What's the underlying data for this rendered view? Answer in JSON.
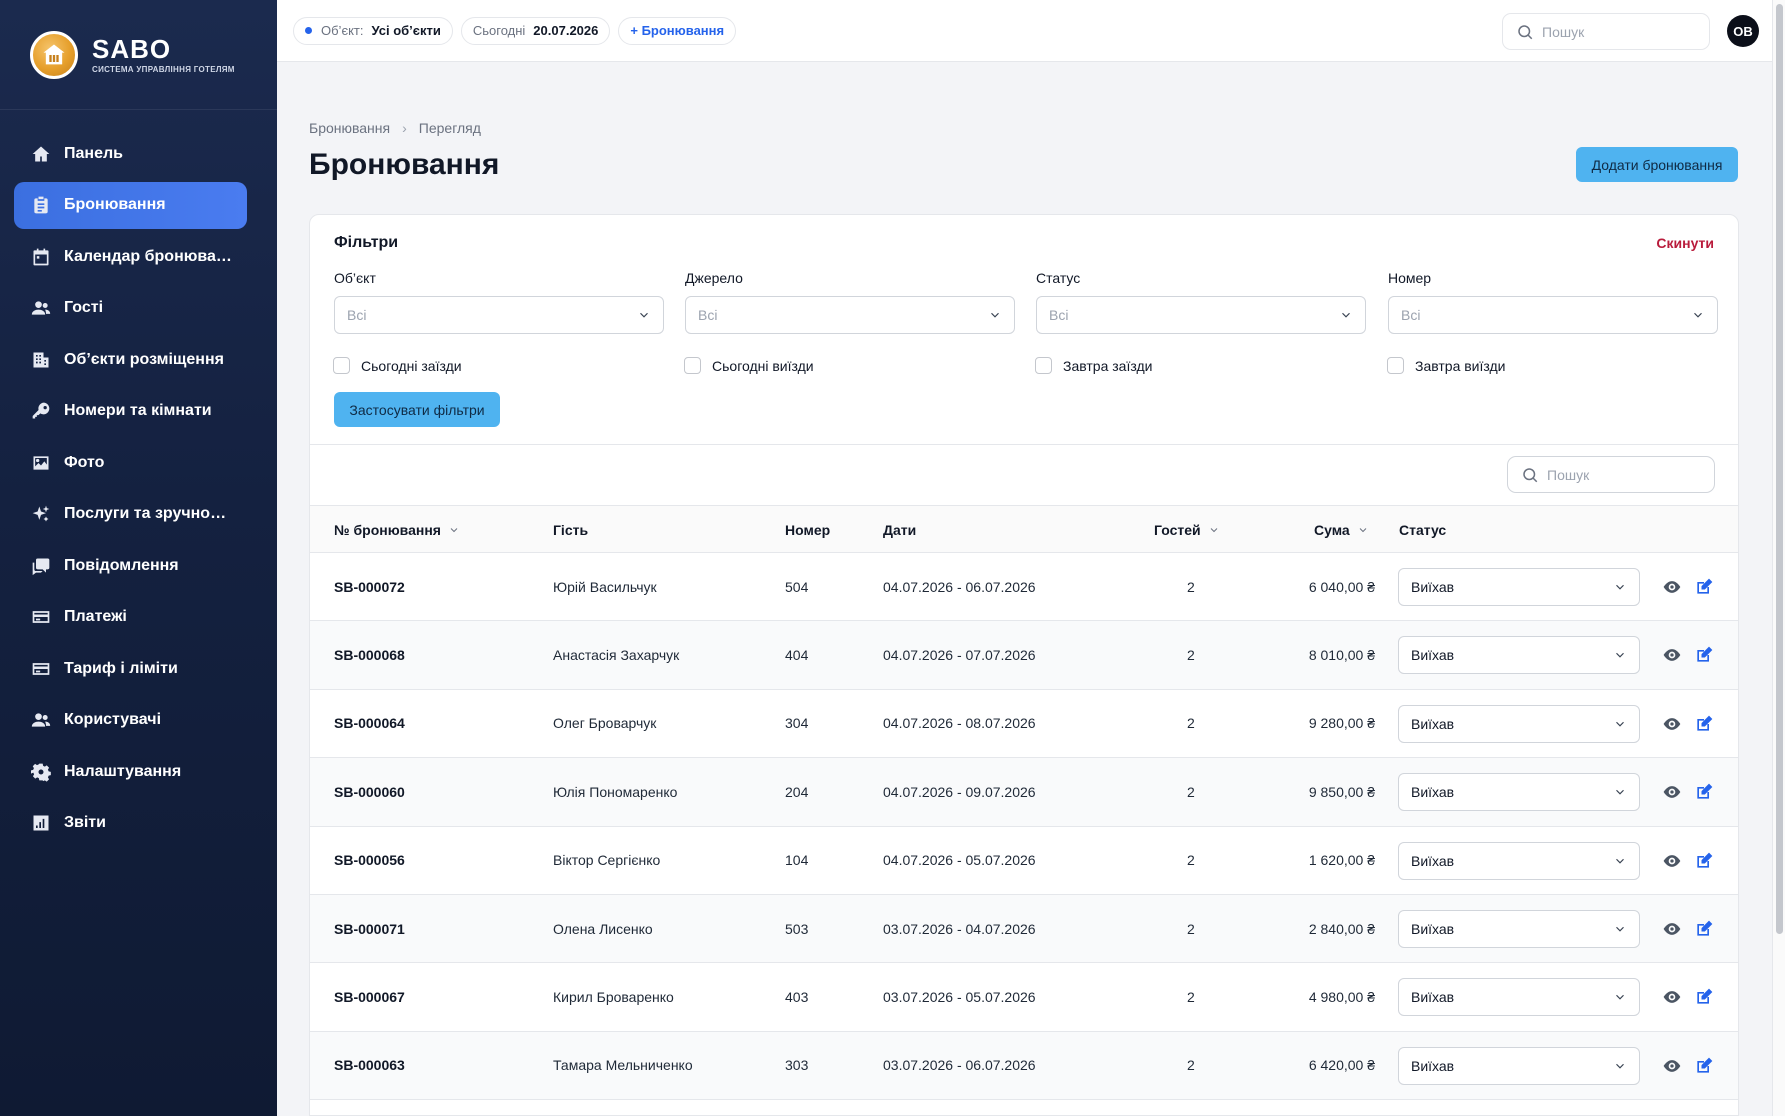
{
  "app": {
    "name": "SABO",
    "subtitle": "СИСТЕМА УПРАВЛІННЯ ГОТЕЛЯМ",
    "accent": "#3b6fe0",
    "button_color": "#4fb3f0"
  },
  "sidebar": {
    "items": [
      {
        "label": "Панель",
        "icon": "home-icon",
        "active": false
      },
      {
        "label": "Бронювання",
        "icon": "clipboard-icon",
        "active": true
      },
      {
        "label": "Календар бронюва…",
        "icon": "calendar-icon",
        "active": false
      },
      {
        "label": "Гості",
        "icon": "users-icon",
        "active": false
      },
      {
        "label": "Об’єкти розміщення",
        "icon": "building-icon",
        "active": false
      },
      {
        "label": "Номери та кімнати",
        "icon": "key-icon",
        "active": false
      },
      {
        "label": "Фото",
        "icon": "image-icon",
        "active": false
      },
      {
        "label": "Послуги та зручно…",
        "icon": "sparkles-icon",
        "active": false
      },
      {
        "label": "Повідомлення",
        "icon": "chat-icon",
        "active": false
      },
      {
        "label": "Платежі",
        "icon": "credit-card-icon",
        "active": false
      },
      {
        "label": "Тариф і ліміти",
        "icon": "credit-card-icon",
        "active": false
      },
      {
        "label": "Користувачі",
        "icon": "users-icon",
        "active": false
      },
      {
        "label": "Налаштування",
        "icon": "gear-icon",
        "active": false
      },
      {
        "label": "Звіти",
        "icon": "chart-icon",
        "active": false
      }
    ]
  },
  "topbar": {
    "object_label": "Об’єкт:",
    "object_value": "Усі об’єкти",
    "today_label": "Сьогодні",
    "today_value": "20.07.2026",
    "new_booking": "+ Бронювання",
    "search_placeholder": "Пошук",
    "avatar_initials": "OB"
  },
  "breadcrumb": {
    "parent": "Бронювання",
    "current": "Перегляд"
  },
  "page": {
    "title": "Бронювання",
    "add_button": "Додати бронювання"
  },
  "filters": {
    "title": "Фільтри",
    "reset": "Скинути",
    "fields": [
      {
        "label": "Об’єкт",
        "value": "Всі"
      },
      {
        "label": "Джерело",
        "value": "Всі"
      },
      {
        "label": "Статус",
        "value": "Всі"
      },
      {
        "label": "Номер",
        "value": "Всі"
      }
    ],
    "checks": [
      "Сьогодні заїзди",
      "Сьогодні виїзди",
      "Завтра заїзди",
      "Завтра виїзди"
    ],
    "apply": "Застосувати фільтри"
  },
  "table": {
    "search_placeholder": "Пошук",
    "headers": {
      "number": "№ бронювання",
      "guest": "Гість",
      "room": "Номер",
      "dates": "Дати",
      "guests": "Гостей",
      "sum": "Сума",
      "status": "Статус"
    },
    "rows": [
      {
        "number": "SB-000072",
        "guest": "Юрій Васильчук",
        "room": "504",
        "dates": "04.07.2026 - 06.07.2026",
        "guests": "2",
        "sum": "6 040,00 ₴",
        "status": "Виїхав"
      },
      {
        "number": "SB-000068",
        "guest": "Анастасія Захарчук",
        "room": "404",
        "dates": "04.07.2026 - 07.07.2026",
        "guests": "2",
        "sum": "8 010,00 ₴",
        "status": "Виїхав"
      },
      {
        "number": "SB-000064",
        "guest": "Олег Броварчук",
        "room": "304",
        "dates": "04.07.2026 - 08.07.2026",
        "guests": "2",
        "sum": "9 280,00 ₴",
        "status": "Виїхав"
      },
      {
        "number": "SB-000060",
        "guest": "Юлія Пономаренко",
        "room": "204",
        "dates": "04.07.2026 - 09.07.2026",
        "guests": "2",
        "sum": "9 850,00 ₴",
        "status": "Виїхав"
      },
      {
        "number": "SB-000056",
        "guest": "Віктор Сергієнко",
        "room": "104",
        "dates": "04.07.2026 - 05.07.2026",
        "guests": "2",
        "sum": "1 620,00 ₴",
        "status": "Виїхав"
      },
      {
        "number": "SB-000071",
        "guest": "Олена Лисенко",
        "room": "503",
        "dates": "03.07.2026 - 04.07.2026",
        "guests": "2",
        "sum": "2 840,00 ₴",
        "status": "Виїхав"
      },
      {
        "number": "SB-000067",
        "guest": "Кирил Броваренко",
        "room": "403",
        "dates": "03.07.2026 - 05.07.2026",
        "guests": "2",
        "sum": "4 980,00 ₴",
        "status": "Виїхав"
      },
      {
        "number": "SB-000063",
        "guest": "Тамара Мельниченко",
        "room": "303",
        "dates": "03.07.2026 - 06.07.2026",
        "guests": "2",
        "sum": "6 420,00 ₴",
        "status": "Виїхав"
      }
    ]
  }
}
